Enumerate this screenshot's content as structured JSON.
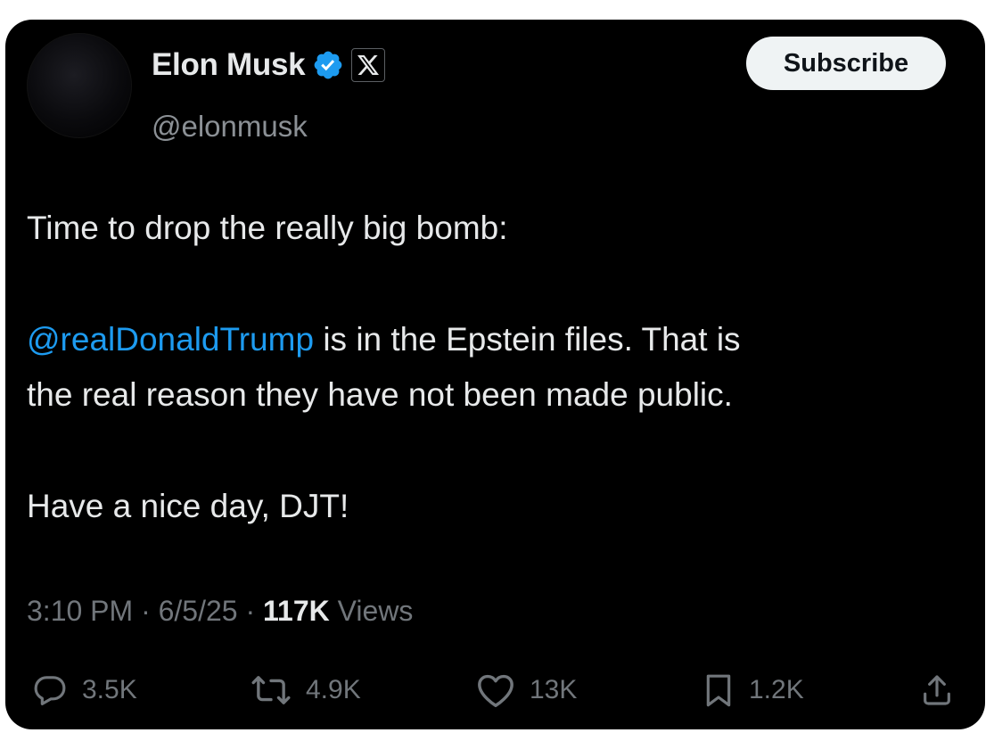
{
  "author": {
    "display_name": "Elon Musk",
    "handle": "@elonmusk",
    "verified_icon": "verified-badge-icon",
    "affiliate_icon": "x-logo-icon"
  },
  "header": {
    "subscribe_label": "Subscribe"
  },
  "tweet": {
    "line1": "Time to drop the really big bomb:",
    "mention": "@realDonaldTrump",
    "line2_rest": " is in the Epstein files. That is",
    "line3": "the real reason they have not been made public.",
    "line4": "Have a nice day, DJT!"
  },
  "meta": {
    "time": "3:10 PM",
    "separator": " · ",
    "date": "6/5/25",
    "views_count": "117K",
    "views_label": " Views"
  },
  "actions": {
    "replies": "3.5K",
    "reposts": "4.9K",
    "likes": "13K",
    "bookmarks": "1.2K"
  },
  "colors": {
    "background": "#000000",
    "primary_text": "#e7e9ea",
    "secondary_text": "#71767b",
    "accent": "#1d9bf0",
    "button_bg": "#eff3f4"
  }
}
